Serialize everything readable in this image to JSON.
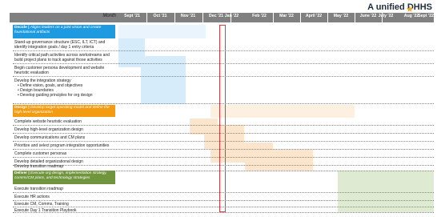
{
  "title": "A unified DHHS",
  "month_label": "Month",
  "months": [
    "Sept '21",
    "Oct '21",
    "Nov '21",
    "Dec '21",
    "Jan '22",
    "Feb '22",
    "Mar '22",
    "April '22",
    "May '22",
    "June '22",
    "July '22",
    "Aug '22",
    "Sept '22"
  ],
  "colors": {
    "decide": "#1e9be0",
    "design": "#f39c12",
    "deliver": "#70953c",
    "decide_bar": "#d6ecfb",
    "design_bar": "#fbe5cc",
    "deliver_bar": "#dfead3"
  },
  "phases": {
    "decide": {
      "label": "Decide |",
      "desc": "Aligns leaders on a joint vision and create foundational artifacts"
    },
    "design": {
      "label": "Design |",
      "desc": "Develop target operating model and define the high-level organization"
    },
    "deliver": {
      "label": "Deliver |",
      "desc": "Execute org design, implementation strategy, comms/CM plans, and technology strategies"
    }
  },
  "tasks": {
    "decide": [
      "Stand-up governance structure (ESC, ILT, ICT) and identify integration goals / day 1 entry criteria",
      "Identify critical path activities across workstreams and build project plans to track against those activities",
      "Begin customer persona development and website heuristic evaluation",
      "Develop the integration strategy"
    ],
    "decide_bullets": [
      "Define vision, goals, and objectives",
      "Design boundaries",
      "Develop guiding principles for org design"
    ],
    "design": [
      "Complete website heuristic evaluation",
      "Develop high-level organization design",
      "Develop communications and CM plans",
      "Prioritize and select program integration opportunities",
      "Complete customer personas",
      "Develop detailed organizational design",
      "Develop transition roadmap"
    ],
    "deliver": [
      "Execute transition roadmap",
      "Execute HR actions",
      "Execute CM, Comms, Training",
      "Execute Day 1 Transition Playbook"
    ]
  }
}
